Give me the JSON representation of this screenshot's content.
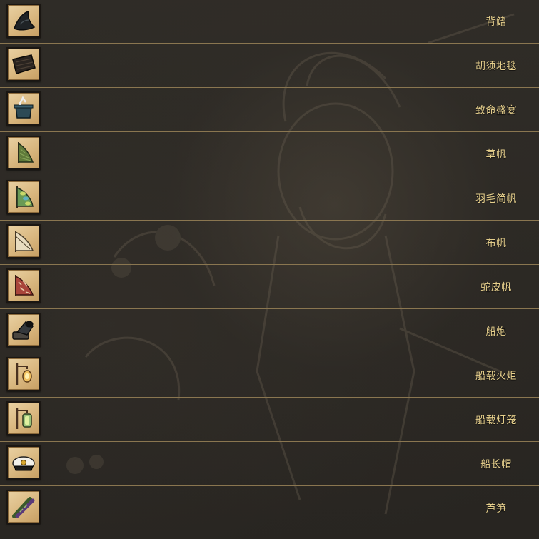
{
  "items": [
    {
      "name": "背鳍",
      "icon": "fin-icon"
    },
    {
      "name": "胡须地毯",
      "icon": "beard-rug-icon"
    },
    {
      "name": "致命盛宴",
      "icon": "cooking-pot-icon"
    },
    {
      "name": "草帆",
      "icon": "grass-sail-icon"
    },
    {
      "name": "羽毛简帆",
      "icon": "feather-sail-icon"
    },
    {
      "name": "布帆",
      "icon": "cloth-sail-icon"
    },
    {
      "name": "蛇皮帆",
      "icon": "snakeskin-sail-icon"
    },
    {
      "name": "船炮",
      "icon": "boat-cannon-icon"
    },
    {
      "name": "船载火炬",
      "icon": "boat-torch-icon"
    },
    {
      "name": "船载灯笼",
      "icon": "boat-lantern-icon"
    },
    {
      "name": "船长帽",
      "icon": "captain-hat-icon"
    },
    {
      "name": "芦笋",
      "icon": "asparagus-icon"
    }
  ],
  "colors": {
    "label": "#e6cf8c",
    "divider": "#8a7650",
    "slot": "#d9b77f",
    "background": "#2b2824"
  }
}
